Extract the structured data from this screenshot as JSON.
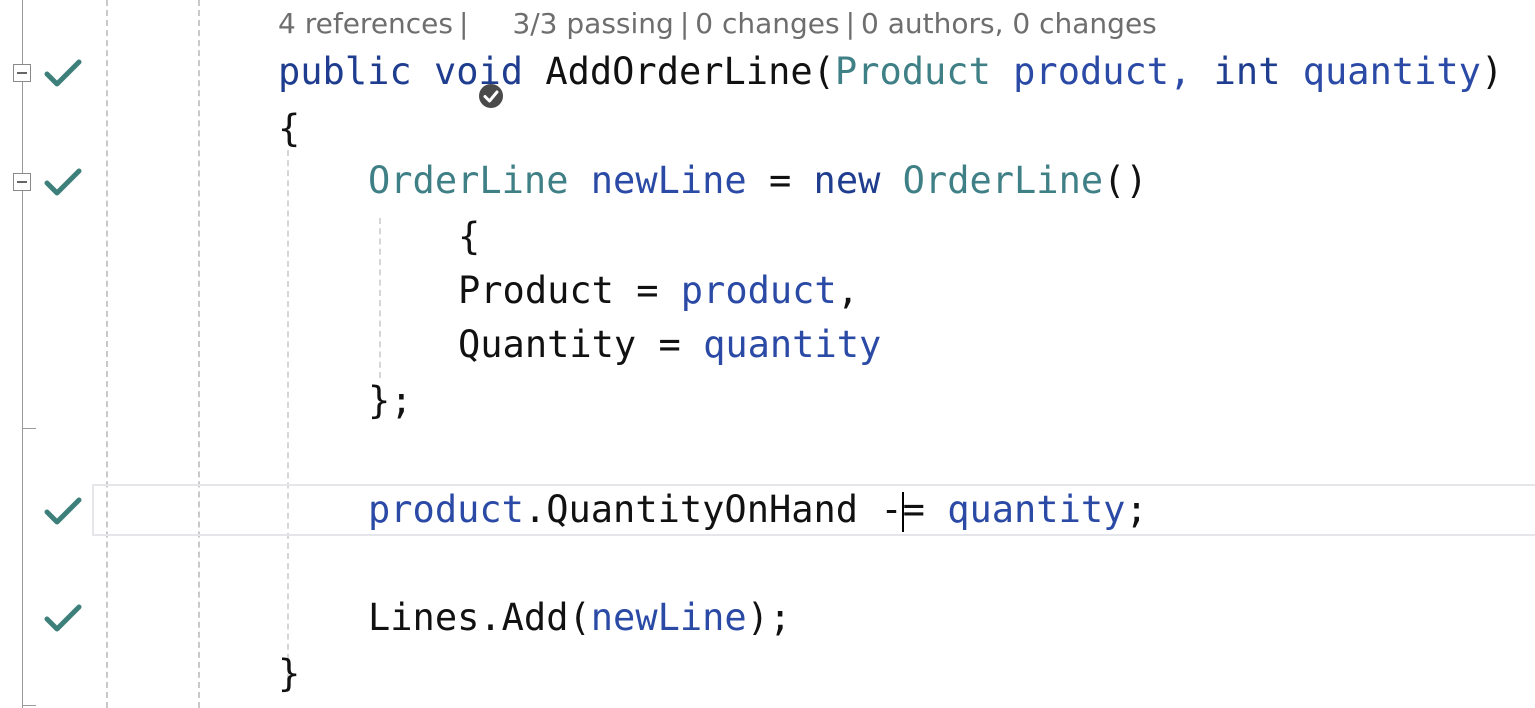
{
  "codelens": {
    "references": "4 references",
    "tests": "3/3 passing",
    "changes": "0 changes",
    "authors": "0 authors, 0 changes"
  },
  "code": {
    "signature": {
      "public": "public",
      "void": "void",
      "name": "AddOrderLine(",
      "param1_type": "Product",
      "param1_name": "product,",
      "param2_type": "int",
      "param2_name": "quantity",
      "close": ")"
    },
    "open_brace": "{",
    "decl": {
      "type": "OrderLine",
      "var": "newLine",
      "eq": "=",
      "new": "new",
      "ctor": "OrderLine",
      "parens": "()"
    },
    "init_open": "{",
    "init_product": {
      "prop": "Product",
      "eq": "=",
      "value": "product",
      "comma": ","
    },
    "init_quantity": {
      "prop": "Quantity",
      "eq": "=",
      "value": "quantity"
    },
    "init_close": "};",
    "assign": {
      "target": "product",
      "member": ".QuantityOnHand",
      "op_left": "-",
      "op_right": "=",
      "value": "quantity",
      "end": ";"
    },
    "add_call": {
      "obj": "Lines.Add(",
      "arg": "newLine",
      "end": ");"
    },
    "close_brace": "}"
  },
  "colors": {
    "keyword": "#1f3d8f",
    "type": "#3f7f86",
    "identifier": "#2a4aa6",
    "test_pass": "#3d7f7a"
  }
}
